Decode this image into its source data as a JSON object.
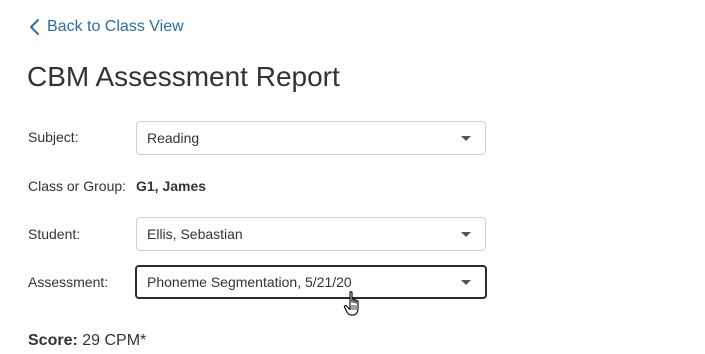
{
  "nav": {
    "back_label": "Back to Class View"
  },
  "page": {
    "title": "CBM Assessment Report"
  },
  "form": {
    "subject": {
      "label": "Subject:",
      "value": "Reading"
    },
    "class_group": {
      "label": "Class or Group:",
      "value": "G1, James"
    },
    "student": {
      "label": "Student:",
      "value": "Ellis, Sebastian"
    },
    "assessment": {
      "label": "Assessment:",
      "value": "Phoneme Segmentation, 5/21/20"
    }
  },
  "score": {
    "label": "Score:",
    "value": "29 CPM*"
  },
  "colors": {
    "link": "#2e6da4",
    "text": "#333333",
    "border": "#cfcfcf",
    "focus_border": "#2b2b2b"
  },
  "icons": {
    "back": "chevron-left-icon",
    "dropdown": "chevron-down-icon",
    "cursor": "hand-pointer-cursor-icon"
  }
}
